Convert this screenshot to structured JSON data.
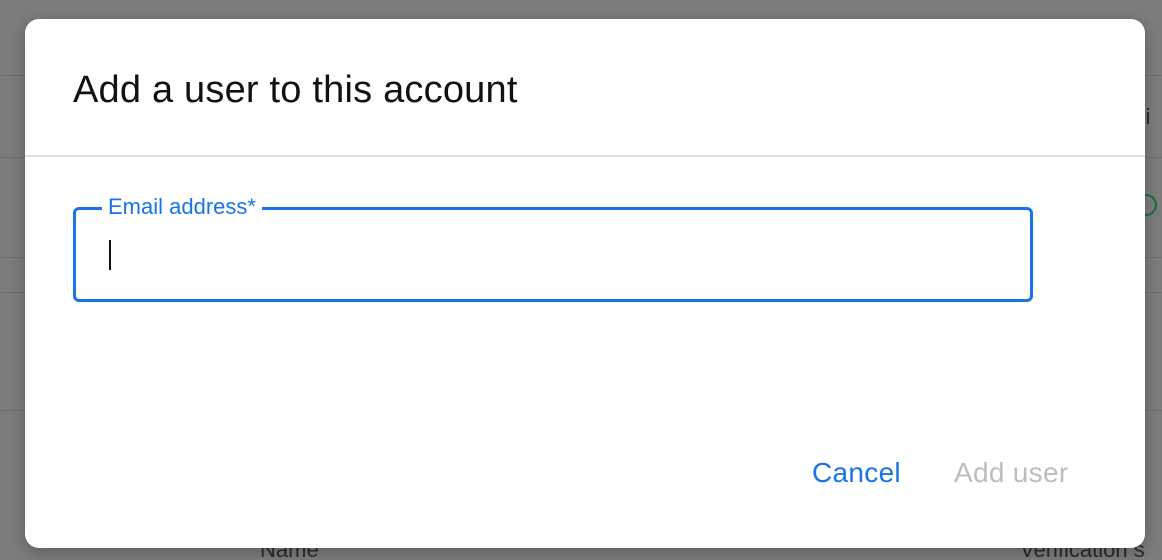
{
  "background": {
    "header_fragment": "eri",
    "column_name": "Name",
    "column_verification": "Verification s"
  },
  "dialog": {
    "title": "Add a user to this account",
    "email_field": {
      "label": "Email address*",
      "value": "",
      "placeholder": ""
    },
    "buttons": {
      "cancel_label": "Cancel",
      "add_user_label": "Add user"
    }
  },
  "colors": {
    "accent": "#1a73e8",
    "disabled_text": "#bdbdbd",
    "overlay": "#7f7f7f"
  }
}
